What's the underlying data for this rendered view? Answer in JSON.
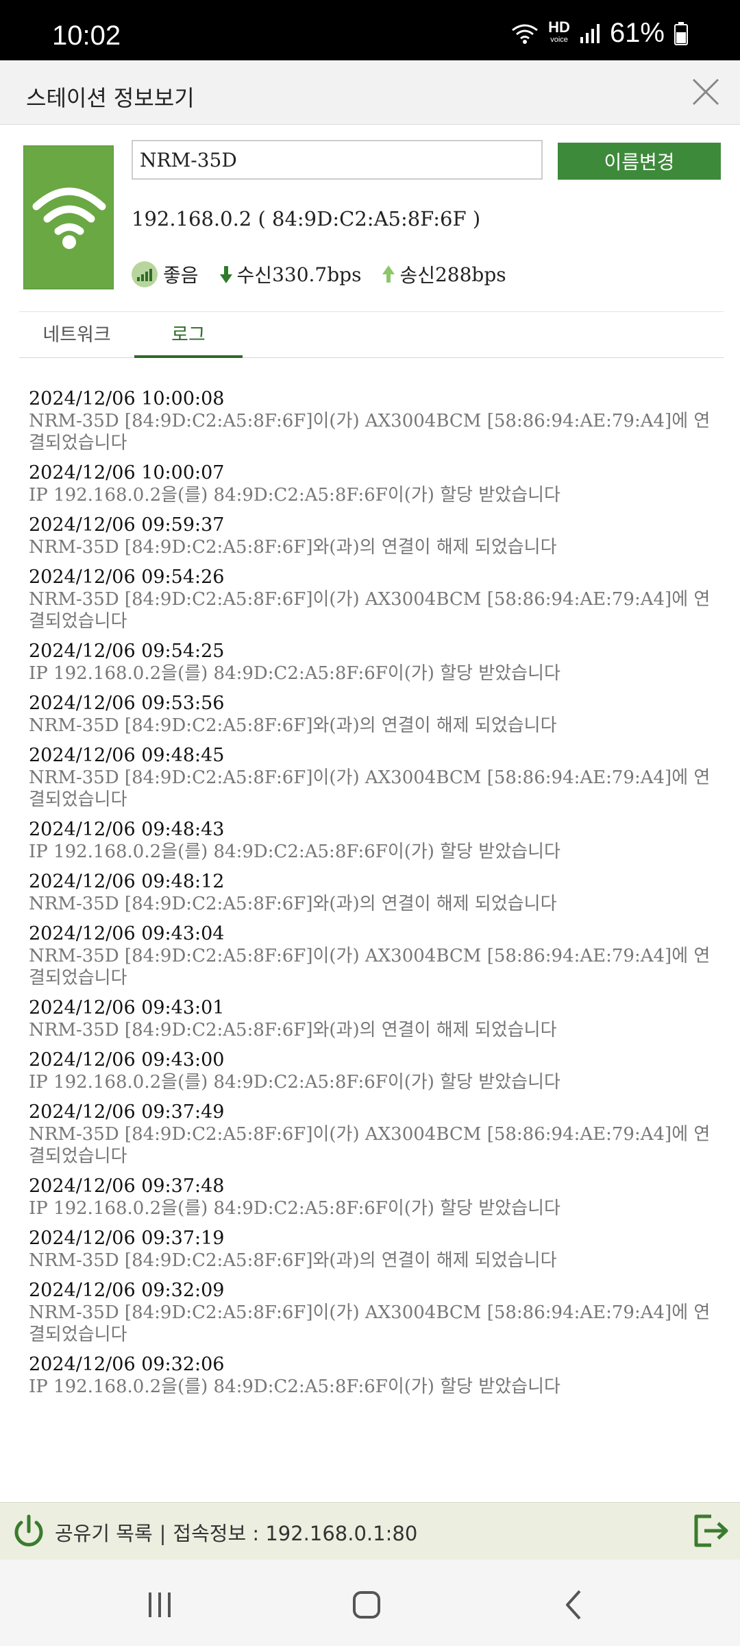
{
  "status_bar": {
    "time": "10:02",
    "hd": "HD",
    "voice": "voice",
    "battery": "61%"
  },
  "header": {
    "title": "스테이션 정보보기"
  },
  "device": {
    "name_value": "NRM-35D",
    "rename_label": "이름변경",
    "ip_mac": "192.168.0.2 ( 84:9D:C2:A5:8F:6F )",
    "signal_label": "좋음",
    "rx_label": "수신",
    "rx_value": "330.7bps",
    "tx_label": "송신",
    "tx_value": "288bps"
  },
  "tabs": [
    {
      "label": "네트워크"
    },
    {
      "label": "로그"
    }
  ],
  "log": [
    {
      "time": "2024/12/06 10:00:08",
      "msg": "NRM-35D [84:9D:C2:A5:8F:6F]이(가) AX3004BCM [58:86:94:AE:79:A4]에 연결되었습니다"
    },
    {
      "time": "2024/12/06 10:00:07",
      "msg": "IP 192.168.0.2을(를) 84:9D:C2:A5:8F:6F이(가) 할당 받았습니다"
    },
    {
      "time": "2024/12/06 09:59:37",
      "msg": "NRM-35D [84:9D:C2:A5:8F:6F]와(과)의 연결이 해제 되었습니다"
    },
    {
      "time": "2024/12/06 09:54:26",
      "msg": "NRM-35D [84:9D:C2:A5:8F:6F]이(가) AX3004BCM [58:86:94:AE:79:A4]에 연결되었습니다"
    },
    {
      "time": "2024/12/06 09:54:25",
      "msg": "IP 192.168.0.2을(를) 84:9D:C2:A5:8F:6F이(가) 할당 받았습니다"
    },
    {
      "time": "2024/12/06 09:53:56",
      "msg": "NRM-35D [84:9D:C2:A5:8F:6F]와(과)의 연결이 해제 되었습니다"
    },
    {
      "time": "2024/12/06 09:48:45",
      "msg": "NRM-35D [84:9D:C2:A5:8F:6F]이(가) AX3004BCM [58:86:94:AE:79:A4]에 연결되었습니다"
    },
    {
      "time": "2024/12/06 09:48:43",
      "msg": "IP 192.168.0.2을(를) 84:9D:C2:A5:8F:6F이(가) 할당 받았습니다"
    },
    {
      "time": "2024/12/06 09:48:12",
      "msg": "NRM-35D [84:9D:C2:A5:8F:6F]와(과)의 연결이 해제 되었습니다"
    },
    {
      "time": "2024/12/06 09:43:04",
      "msg": "NRM-35D [84:9D:C2:A5:8F:6F]이(가) AX3004BCM [58:86:94:AE:79:A4]에 연결되었습니다"
    },
    {
      "time": "2024/12/06 09:43:01",
      "msg": "NRM-35D [84:9D:C2:A5:8F:6F]와(과)의 연결이 해제 되었습니다"
    },
    {
      "time": "2024/12/06 09:43:00",
      "msg": "IP 192.168.0.2을(를) 84:9D:C2:A5:8F:6F이(가) 할당 받았습니다"
    },
    {
      "time": "2024/12/06 09:37:49",
      "msg": "NRM-35D [84:9D:C2:A5:8F:6F]이(가) AX3004BCM [58:86:94:AE:79:A4]에 연결되었습니다"
    },
    {
      "time": "2024/12/06 09:37:48",
      "msg": "IP 192.168.0.2을(를) 84:9D:C2:A5:8F:6F이(가) 할당 받았습니다"
    },
    {
      "time": "2024/12/06 09:37:19",
      "msg": "NRM-35D [84:9D:C2:A5:8F:6F]와(과)의 연결이 해제 되었습니다"
    },
    {
      "time": "2024/12/06 09:32:09",
      "msg": "NRM-35D [84:9D:C2:A5:8F:6F]이(가) AX3004BCM [58:86:94:AE:79:A4]에 연결되었습니다"
    },
    {
      "time": "2024/12/06 09:32:06",
      "msg": "IP 192.168.0.2을(를) 84:9D:C2:A5:8F:6F이(가) 할당 받았습니다"
    }
  ],
  "footer": {
    "router_list": "공유기 목록",
    "separator": "|",
    "conn_info": "접속정보 : 192.168.0.1:80"
  },
  "colors": {
    "accent": "#3e8a3b",
    "device_tile": "#6aa843",
    "footer_bg": "#eceee0"
  },
  "icons": [
    "wifi-icon",
    "close-icon",
    "signal-good-icon",
    "download-arrow-icon",
    "upload-arrow-icon",
    "power-icon",
    "exit-icon",
    "recents-icon",
    "home-icon",
    "back-icon"
  ]
}
